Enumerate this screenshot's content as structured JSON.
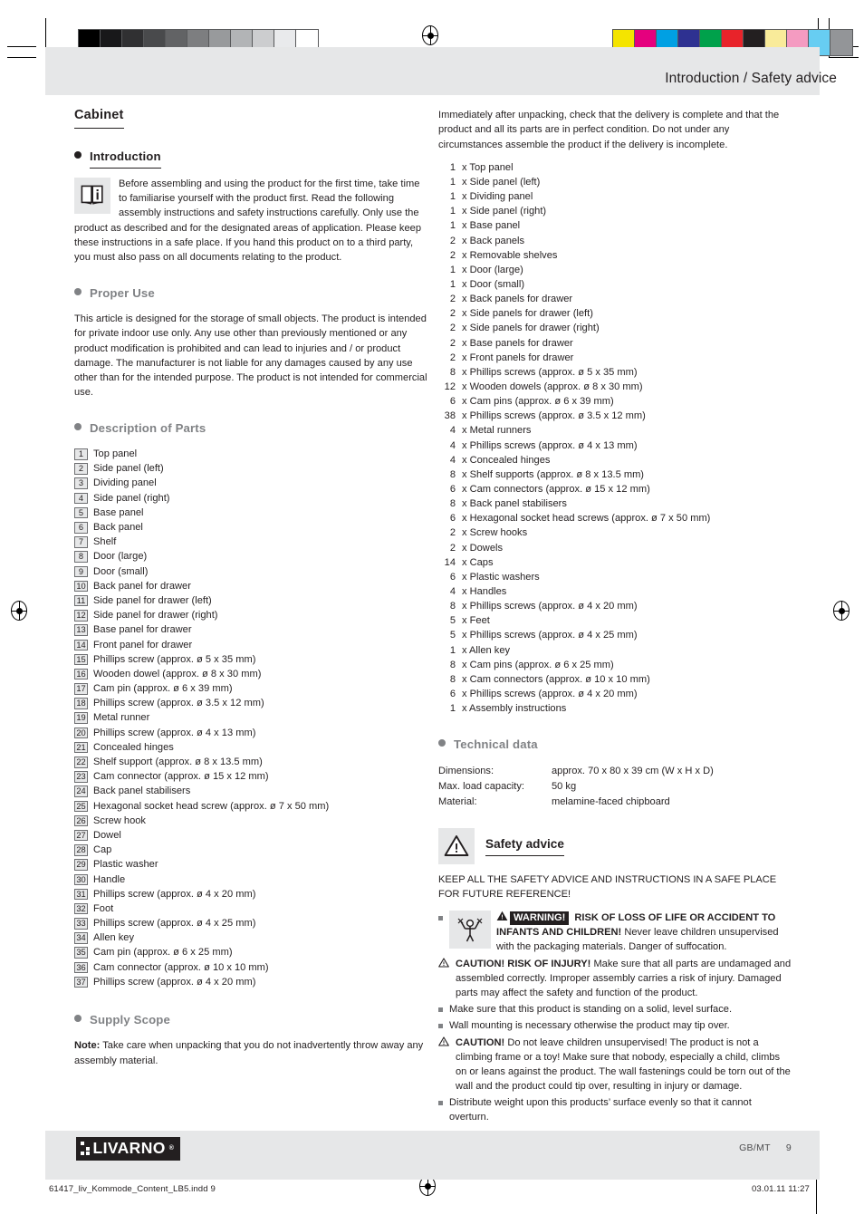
{
  "header": {
    "title": "Introduction / Safety advice"
  },
  "swatches": {
    "gray": [
      "#000000",
      "#18181a",
      "#303032",
      "#494a4c",
      "#626365",
      "#7d7e80",
      "#989a9c",
      "#b2b4b6",
      "#cccdcf",
      "#e9eaec",
      "#ffffff"
    ],
    "color": [
      "#f4e400",
      "#e5007e",
      "#00a0e3",
      "#2e3191",
      "#00a14b",
      "#e8232a",
      "#231f20",
      "#f9eb9a",
      "#f49bc1",
      "#67cdf2",
      "#939598"
    ]
  },
  "left": {
    "doc_title": "Cabinet",
    "introduction": {
      "heading": "Introduction",
      "icon": "book-info-icon",
      "body": "Before assembling and using the product for the first time, take time to familiarise yourself with the product first. Read the following assembly instructions and safety instructions carefully. Only use the product as described and for the designated areas of application. Please keep these instructions in a safe place. If you hand this product on to a third party, you must also pass on all documents relating to the product."
    },
    "proper_use": {
      "heading": "Proper Use",
      "body": "This article is designed for the storage of small objects. The product is intended for private indoor use only. Any use other than previously mentioned or any product modification is prohibited and can lead to injuries and / or product damage. The manufacturer is not liable for any damages caused by any use other than for the intended purpose. The product is not intended for commercial use."
    },
    "description_of_parts": {
      "heading": "Description of Parts",
      "items": [
        {
          "num": "1",
          "label": "Top panel"
        },
        {
          "num": "2",
          "label": "Side panel (left)"
        },
        {
          "num": "3",
          "label": "Dividing panel"
        },
        {
          "num": "4",
          "label": "Side panel (right)"
        },
        {
          "num": "5",
          "label": "Base panel"
        },
        {
          "num": "6",
          "label": "Back panel"
        },
        {
          "num": "7",
          "label": "Shelf"
        },
        {
          "num": "8",
          "label": "Door (large)"
        },
        {
          "num": "9",
          "label": "Door (small)"
        },
        {
          "num": "10",
          "label": "Back panel for drawer"
        },
        {
          "num": "11",
          "label": "Side panel for drawer (left)"
        },
        {
          "num": "12",
          "label": "Side panel for drawer (right)"
        },
        {
          "num": "13",
          "label": "Base panel for drawer"
        },
        {
          "num": "14",
          "label": "Front panel for drawer"
        },
        {
          "num": "15",
          "label": "Phillips screw (approx. ø 5 x 35 mm)"
        },
        {
          "num": "16",
          "label": "Wooden dowel (approx. ø 8 x 30 mm)"
        },
        {
          "num": "17",
          "label": "Cam pin (approx. ø 6 x 39 mm)"
        },
        {
          "num": "18",
          "label": "Phillips screw (approx. ø 3.5 x 12 mm)"
        },
        {
          "num": "19",
          "label": "Metal runner"
        },
        {
          "num": "20",
          "label": "Phillips screw (approx. ø 4 x 13 mm)"
        },
        {
          "num": "21",
          "label": "Concealed hinges"
        },
        {
          "num": "22",
          "label": "Shelf support (approx. ø 8 x 13.5 mm)"
        },
        {
          "num": "23",
          "label": "Cam connector (approx. ø 15 x 12 mm)"
        },
        {
          "num": "24",
          "label": "Back panel stabilisers"
        },
        {
          "num": "25",
          "label": "Hexagonal socket head screw (approx. ø 7 x 50 mm)"
        },
        {
          "num": "26",
          "label": "Screw hook"
        },
        {
          "num": "27",
          "label": "Dowel"
        },
        {
          "num": "28",
          "label": "Cap"
        },
        {
          "num": "29",
          "label": "Plastic washer"
        },
        {
          "num": "30",
          "label": "Handle"
        },
        {
          "num": "31",
          "label": "Phillips screw (approx. ø 4 x 20 mm)"
        },
        {
          "num": "32",
          "label": "Foot"
        },
        {
          "num": "33",
          "label": "Phillips screw (approx. ø 4 x 25 mm)"
        },
        {
          "num": "34",
          "label": "Allen key"
        },
        {
          "num": "35",
          "label": "Cam pin (approx. ø 6 x 25 mm)"
        },
        {
          "num": "36",
          "label": "Cam connector (approx. ø 10 x 10 mm)"
        },
        {
          "num": "37",
          "label": "Phillips screw (approx. ø 4 x 20 mm)"
        }
      ]
    },
    "supply_scope": {
      "heading": "Supply Scope",
      "note_label": "Note:",
      "note_body": " Take care when unpacking that you do not inadvertently throw away any assembly material."
    }
  },
  "right": {
    "intro_paragraph": "Immediately after unpacking, check that the delivery is complete and that the product and all its parts are in perfect condition. Do not under any circumstances assemble the product if the delivery is incomplete.",
    "supply_items": [
      {
        "qty": "1",
        "label": "x Top panel"
      },
      {
        "qty": "1",
        "label": "x Side panel (left)"
      },
      {
        "qty": "1",
        "label": "x Dividing panel"
      },
      {
        "qty": "1",
        "label": "x Side panel (right)"
      },
      {
        "qty": "1",
        "label": "x Base panel"
      },
      {
        "qty": "2",
        "label": "x Back panels"
      },
      {
        "qty": "2",
        "label": "x Removable shelves"
      },
      {
        "qty": "1",
        "label": "x Door (large)"
      },
      {
        "qty": "1",
        "label": "x Door (small)"
      },
      {
        "qty": "2",
        "label": "x Back panels for drawer"
      },
      {
        "qty": "2",
        "label": "x Side panels for drawer (left)"
      },
      {
        "qty": "2",
        "label": "x Side panels for drawer (right)"
      },
      {
        "qty": "2",
        "label": "x Base panels for drawer"
      },
      {
        "qty": "2",
        "label": "x Front panels for drawer"
      },
      {
        "qty": "8",
        "label": "x Phillips screws (approx. ø 5 x 35 mm)"
      },
      {
        "qty": "12",
        "label": "x Wooden dowels (approx. ø 8 x 30 mm)"
      },
      {
        "qty": "6",
        "label": "x Cam pins (approx. ø 6 x 39 mm)"
      },
      {
        "qty": "38",
        "label": "x Phillips screws (approx. ø 3.5 x 12 mm)"
      },
      {
        "qty": "4",
        "label": "x Metal runners"
      },
      {
        "qty": "4",
        "label": "x Phillips screws (approx. ø 4 x 13 mm)"
      },
      {
        "qty": "4",
        "label": "x Concealed hinges"
      },
      {
        "qty": "8",
        "label": "x Shelf supports (approx. ø 8 x 13.5 mm)"
      },
      {
        "qty": "6",
        "label": "x Cam connectors (approx. ø 15 x 12 mm)"
      },
      {
        "qty": "8",
        "label": "x Back panel stabilisers"
      },
      {
        "qty": "6",
        "label": "x Hexagonal socket head screws (approx. ø 7 x 50 mm)"
      },
      {
        "qty": "2",
        "label": "x Screw hooks"
      },
      {
        "qty": "2",
        "label": "x Dowels"
      },
      {
        "qty": "14",
        "label": "x Caps"
      },
      {
        "qty": "6",
        "label": "x Plastic washers"
      },
      {
        "qty": "4",
        "label": "x Handles"
      },
      {
        "qty": "8",
        "label": "x Phillips screws (approx. ø 4 x 20 mm)"
      },
      {
        "qty": "5",
        "label": "x Feet"
      },
      {
        "qty": "5",
        "label": "x Phillips screws (approx. ø 4 x 25 mm)"
      },
      {
        "qty": "1",
        "label": "x Allen key"
      },
      {
        "qty": "8",
        "label": "x Cam pins (approx. ø 6 x 25 mm)"
      },
      {
        "qty": "8",
        "label": "x Cam connectors (approx. ø 10 x 10 mm)"
      },
      {
        "qty": "6",
        "label": "x Phillips screws (approx. ø 4 x 20 mm)"
      },
      {
        "qty": "1",
        "label": "x Assembly instructions"
      }
    ],
    "technical_data": {
      "heading": "Technical data",
      "rows": [
        {
          "label": "Dimensions:",
          "value": "approx. 70 x 80 x 39 cm (W x H x D)"
        },
        {
          "label": "Max. load capacity:",
          "value": "50 kg"
        },
        {
          "label": "Material:",
          "value": "melamine-faced chipboard"
        }
      ]
    },
    "safety_advice": {
      "heading": "Safety advice",
      "icon": "warning-triangle-icon",
      "keep_all": "KEEP ALL THE SAFETY ADVICE AND INSTRUCTIONS IN A SAFE PLACE FOR FUTURE REFERENCE!",
      "bullets": [
        {
          "marker": "square",
          "has_child_icon": true,
          "badge": "WARNING!",
          "bold": " RISK OF LOSS OF LIFE OR ACCIDENT TO INFANTS AND CHILDREN!",
          "text": " Never leave children unsupervised with the packaging materials. Danger of suffocation."
        },
        {
          "marker": "triangle",
          "has_child_icon": false,
          "badge": "",
          "bold": "CAUTION! RISK OF INJURY!",
          "text": " Make sure that all parts are undamaged and assembled correctly. Improper assembly carries a risk of injury. Damaged parts may affect the safety and function of the product."
        },
        {
          "marker": "square",
          "has_child_icon": false,
          "badge": "",
          "bold": "",
          "text": "Make sure that this product is standing on a solid, level surface."
        },
        {
          "marker": "square",
          "has_child_icon": false,
          "badge": "",
          "bold": "",
          "text": "Wall mounting is necessary otherwise the product may tip over."
        },
        {
          "marker": "triangle",
          "has_child_icon": false,
          "badge": "",
          "bold": "CAUTION!",
          "text": " Do not leave children unsupervised! The product is not a climbing frame or a toy! Make sure that nobody, especially a child, climbs on or leans against the product. The wall fastenings could be torn out of the wall and the product could tip over, resulting in injury or damage."
        },
        {
          "marker": "square",
          "has_child_icon": false,
          "badge": "",
          "bold": "",
          "text": "Distribute weight upon this products’ surface evenly so that it cannot overturn."
        }
      ]
    }
  },
  "footer": {
    "brand": "LIVARNO",
    "locale": "GB/MT",
    "page_number": "9",
    "print_file": "61417_liv_Kommode_Content_LB5.indd   9",
    "print_date": "03.01.11   11:27"
  }
}
